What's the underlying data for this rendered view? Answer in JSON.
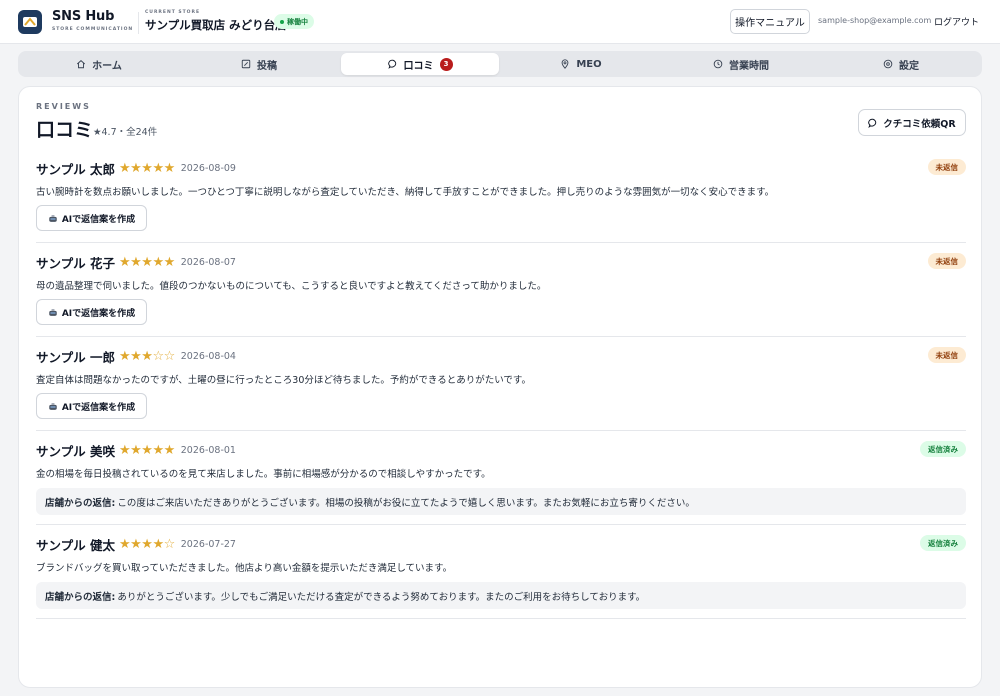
{
  "header": {
    "brand_name": "SNS Hub",
    "brand_sub": "STORE COMMUNICATION",
    "store_label": "CURRENT STORE",
    "store_name": "サンプル買取店 みどり台店",
    "store_status": "稼働中",
    "manual_label": "操作マニュアル",
    "email": "sample-shop@example.com",
    "logout_label": "ログアウト"
  },
  "tabs": [
    {
      "label": "ホーム",
      "icon": "home-icon"
    },
    {
      "label": "投稿",
      "icon": "edit-icon"
    },
    {
      "label": "口コミ",
      "icon": "chat-icon",
      "count": "3",
      "active": true
    },
    {
      "label": "MEO",
      "icon": "map-pin-icon"
    },
    {
      "label": "営業時間",
      "icon": "clock-icon"
    },
    {
      "label": "設定",
      "icon": "gear-icon"
    }
  ],
  "page": {
    "section_label": "REVIEWS",
    "title": "口コミ",
    "subtitle": "★4.7・全24件",
    "qr_button": "クチコミ依頼QR"
  },
  "ai_button_label": "AIで返信案を作成",
  "reply_label": "店舗からの返信:",
  "reviews": [
    {
      "name": "サンプル 太郎",
      "stars": 5,
      "date": "2026-08-09",
      "status": "未返信",
      "text": "古い腕時計を数点お願いしました。一つひとつ丁寧に説明しながら査定していただき、納得して手放すことができました。押し売りのような雰囲気が一切なく安心できます。"
    },
    {
      "name": "サンプル 花子",
      "stars": 5,
      "date": "2026-08-07",
      "status": "未返信",
      "text": "母の遺品整理で伺いました。値段のつかないものについても、こうすると良いですよと教えてくださって助かりました。"
    },
    {
      "name": "サンプル 一郎",
      "stars": 3,
      "date": "2026-08-04",
      "status": "未返信",
      "text": "査定自体は問題なかったのですが、土曜の昼に行ったところ30分ほど待ちました。予約ができるとありがたいです。"
    },
    {
      "name": "サンプル 美咲",
      "stars": 5,
      "date": "2026-08-01",
      "status": "返信済み",
      "text": "金の相場を毎日投稿されているのを見て来店しました。事前に相場感が分かるので相談しやすかったです。",
      "reply": "この度はご来店いただきありがとうございます。相場の投稿がお役に立てたようで嬉しく思います。またお気軽にお立ち寄りください。"
    },
    {
      "name": "サンプル 健太",
      "stars": 4,
      "date": "2026-07-27",
      "status": "返信済み",
      "text": "ブランドバッグを買い取っていただきました。他店より高い金額を提示いただき満足しています。",
      "reply": "ありがとうございます。少しでもご満足いただける査定ができるよう努めております。またのご利用をお待ちしております。"
    }
  ],
  "colors": {
    "accent_dark": "#1e3a5f",
    "star": "#e0a82e",
    "badge_red": "#b91c1c",
    "pending_bg": "#fdebd3",
    "done_bg": "#dcfce7"
  }
}
